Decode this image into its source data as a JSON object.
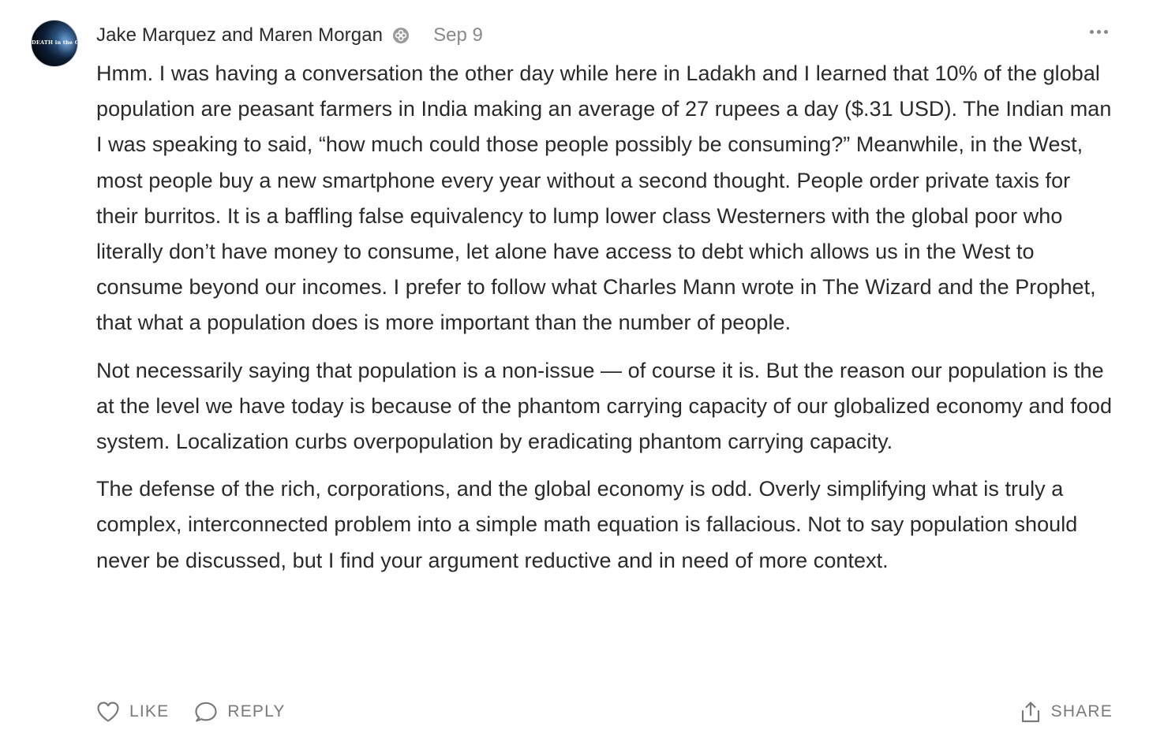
{
  "comment": {
    "avatar": {
      "logo_text": "DEATH in the GARDEN",
      "icon": "earth-globe-avatar"
    },
    "author": "Jake Marquez and Maren Morgan",
    "badge_icon": "subscriber-badge-icon",
    "date": "Sep 9",
    "more_icon": "more-options-icon",
    "paragraphs": [
      "Hmm. I was having a conversation the other day while here in Ladakh and I learned that 10% of the global population are peasant farmers in India making an average of 27 rupees a day ($.31 USD). The Indian man I was speaking to said, “how much could those people possibly be consuming?” Meanwhile, in the West, most people buy a new smartphone every year without a second thought. People order private taxis for their burritos. It is a baffling false equivalency to lump lower class Westerners with the global poor who literally don’t have money to consume, let alone have access to debt which allows us in the West to consume beyond our incomes. I prefer to follow what Charles Mann wrote in The Wizard and the Prophet, that what a population does is more important than the number of people.",
      "Not necessarily saying that population is a non-issue — of course it is. But the reason our population is the at the level we have today is because of the phantom carrying capacity of our globalized economy and food system. Localization curbs overpopulation by eradicating phantom carrying capacity.",
      "The defense of the rich, corporations, and the global economy is odd. Overly simplifying what is truly a complex, interconnected problem into a simple math equation is fallacious. Not to say population should never be discussed, but I find your argument reductive and in need of more context."
    ],
    "actions": {
      "like": {
        "label": "LIKE",
        "icon": "heart-icon"
      },
      "reply": {
        "label": "REPLY",
        "icon": "speech-bubble-icon"
      },
      "share": {
        "label": "SHARE",
        "icon": "share-icon"
      }
    }
  },
  "colors": {
    "text": "#2a2a2a",
    "muted": "#8a8a8a",
    "action": "#7a7a7a"
  }
}
